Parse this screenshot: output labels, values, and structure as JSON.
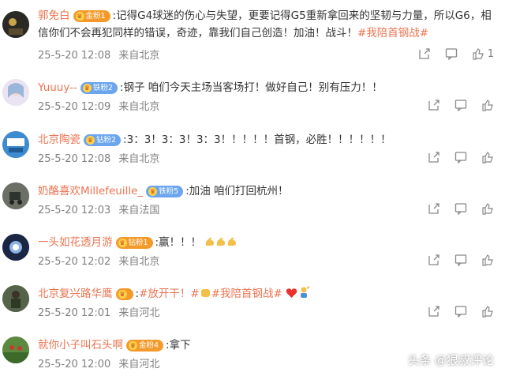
{
  "comments": [
    {
      "username": "郭免白",
      "badge": "金粉1",
      "separator": ":",
      "text": "记得G4球迷的伤心与失望，更要记得G5重新拿回来的坚韧与力量，所以G6，相信你们不会再犯同样的错误，奇迹，靠我们自己创造！加油！战斗！",
      "hashtag": "#我陪首钢战#",
      "timestamp": "25-5-20 12:08",
      "location": "来自北京",
      "likes": "1"
    },
    {
      "username": "Yuuuy--",
      "badge": "铁粉2",
      "separator": ":",
      "text": "钢子 咱们今天主场当客场打！做好自己！别有压力！！",
      "timestamp": "25-5-20 12:09",
      "location": "来自北京"
    },
    {
      "username": "北京陶瓷",
      "badge": "钻粉2",
      "separator": ":",
      "text": "3：3！3：3！3：3！！！！！首钢，必胜！！！！！！",
      "timestamp": "25-5-20 12:08",
      "location": "来自北京"
    },
    {
      "username": "奶酪喜欢Millefeuille_",
      "badge": "铁粉5",
      "separator": ":",
      "text": "加油 咱们打回杭州！",
      "timestamp": "25-5-20 12:03",
      "location": "来自法国"
    },
    {
      "username": "一头如花透月游",
      "badge": "钻粉1",
      "separator": ":",
      "text": "赢！！！",
      "timestamp": "25-5-20 12:02",
      "location": "来自北京"
    },
    {
      "username": "北京复兴路华鹰",
      "badge": "",
      "separator": ":",
      "hashtag1": "#放开干！#",
      "hashtag2": "#我陪首钢战#",
      "timestamp": "25-5-20 12:01",
      "location": "来自河北"
    },
    {
      "username": "就你小子叫石头啊",
      "badge": "金粉4",
      "separator": ":",
      "text": "拿下",
      "timestamp": "25-5-20 12:00",
      "location": "来自河北"
    }
  ],
  "watermark": "头条 @狠叔评论",
  "colors": {
    "accent": "#eb7350",
    "meta": "#808080"
  }
}
